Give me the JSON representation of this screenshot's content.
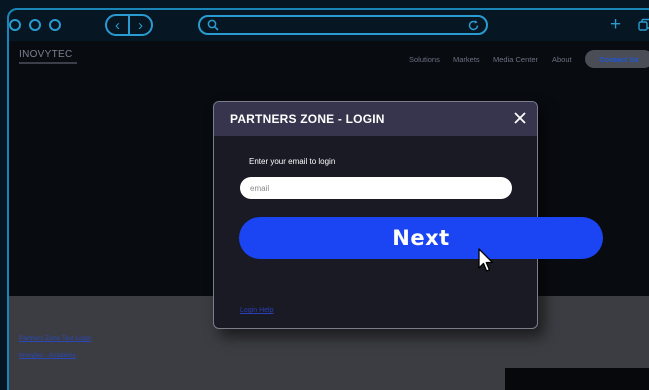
{
  "browser": {
    "icons": [
      "window-dot-icon",
      "back-arrow-icon",
      "forward-arrow-icon",
      "search-icon",
      "reload-icon",
      "plus-icon",
      "tabs-icon"
    ],
    "accent_color": "#2a9bd0"
  },
  "site": {
    "logo": "INOVYTEC",
    "nav": [
      "Solutions",
      "Markets",
      "Media Center",
      "About"
    ],
    "contact_label": "Contact Us",
    "footer_links": [
      "Partners Zone Test Login",
      "Inovytec - Academy"
    ]
  },
  "modal": {
    "title": "PARTNERS ZONE - LOGIN",
    "prompt": "Enter your email to login",
    "email": {
      "value": "",
      "placeholder": "email"
    },
    "next_label": "Next",
    "register_label": "Login Help",
    "close_icon": "close-icon",
    "header_color": "#37354d",
    "button_color": "#1b44f2"
  }
}
